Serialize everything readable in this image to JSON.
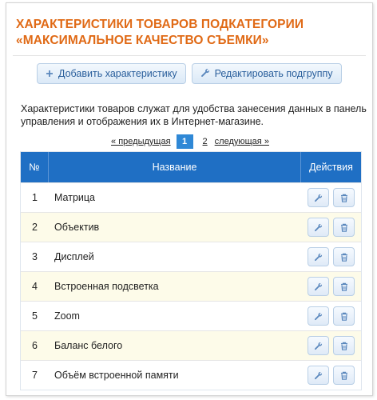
{
  "header": {
    "title_line1": "ХАРАКТЕРИСТИКИ ТОВАРОВ ПОДКАТЕГОРИИ",
    "title_line2": "«МАКСИМАЛЬНОЕ КАЧЕСТВО СЪЕМКИ»"
  },
  "toolbar": {
    "add_label": "Добавить характеристику",
    "add_icon": "plus-icon",
    "edit_label": "Редактировать подгруппу",
    "edit_icon": "wrench-icon"
  },
  "description": "Характеристики товаров служат для удобства занесения данных в панель управления и отображения их в Интернет-магазине.",
  "pagination": {
    "prev_label": "« предыдущая",
    "pages": [
      "1",
      "2"
    ],
    "current": "1",
    "next_label": "следующая »"
  },
  "table": {
    "headers": {
      "num": "№",
      "name": "Название",
      "actions": "Действия"
    },
    "rows": [
      {
        "num": "1",
        "name": "Матрица"
      },
      {
        "num": "2",
        "name": "Объектив"
      },
      {
        "num": "3",
        "name": "Дисплей"
      },
      {
        "num": "4",
        "name": "Встроенная подсветка"
      },
      {
        "num": "5",
        "name": "Zoom"
      },
      {
        "num": "6",
        "name": "Баланс белого"
      },
      {
        "num": "7",
        "name": "Объём встроенной памяти"
      }
    ],
    "row_actions": [
      "wrench-icon",
      "trash-icon"
    ]
  },
  "colors": {
    "title": "#e06a16",
    "table_header": "#1f6fc4",
    "pager_current": "#2f88d6",
    "alt_row": "#fdfbe9"
  }
}
